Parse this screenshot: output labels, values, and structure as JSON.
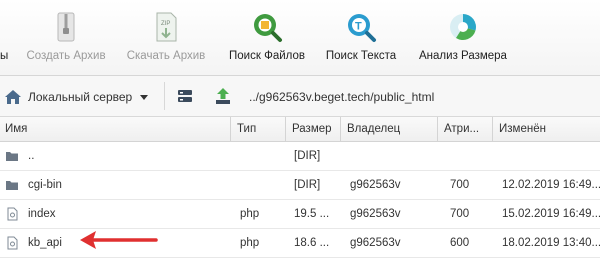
{
  "toolbar": {
    "partial_label": "ы",
    "buttons": [
      {
        "label": "Создать Архив",
        "icon": "zip-archive-icon",
        "enabled": false
      },
      {
        "label": "Скачать Архив",
        "icon": "zip-file-icon",
        "enabled": false
      },
      {
        "label": "Поиск Файлов",
        "icon": "search-files-icon",
        "enabled": true
      },
      {
        "label": "Поиск Текста",
        "icon": "search-text-icon",
        "enabled": true
      },
      {
        "label": "Анализ Размера",
        "icon": "pie-chart-icon",
        "enabled": true
      }
    ]
  },
  "pathbar": {
    "server_label": "Локальный сервер",
    "path": "../g962563v.beget.tech/public_html"
  },
  "table": {
    "headers": {
      "name": "Имя",
      "type": "Тип",
      "size": "Размер",
      "owner": "Владелец",
      "attrs": "Атри...",
      "modified": "Изменён"
    },
    "rows": [
      {
        "name": "..",
        "type": "",
        "size": "[DIR]",
        "owner": "",
        "attrs": "",
        "modified": "",
        "icon": "folder-icon"
      },
      {
        "name": "cgi-bin",
        "type": "",
        "size": "[DIR]",
        "owner": "g962563v",
        "attrs": "700",
        "modified": "12.02.2019 16:49...",
        "icon": "folder-icon"
      },
      {
        "name": "index",
        "type": "php",
        "size": "19.5 ...",
        "owner": "g962563v",
        "attrs": "700",
        "modified": "15.02.2019 16:49...",
        "icon": "file-icon"
      },
      {
        "name": "kb_api",
        "type": "php",
        "size": "18.6 ...",
        "owner": "g962563v",
        "attrs": "600",
        "modified": "18.02.2019 13:40...",
        "icon": "file-icon"
      }
    ]
  },
  "colors": {
    "arrow": "#e03030",
    "folder": "#6b7785",
    "disabled_text": "#9a9a9a"
  }
}
